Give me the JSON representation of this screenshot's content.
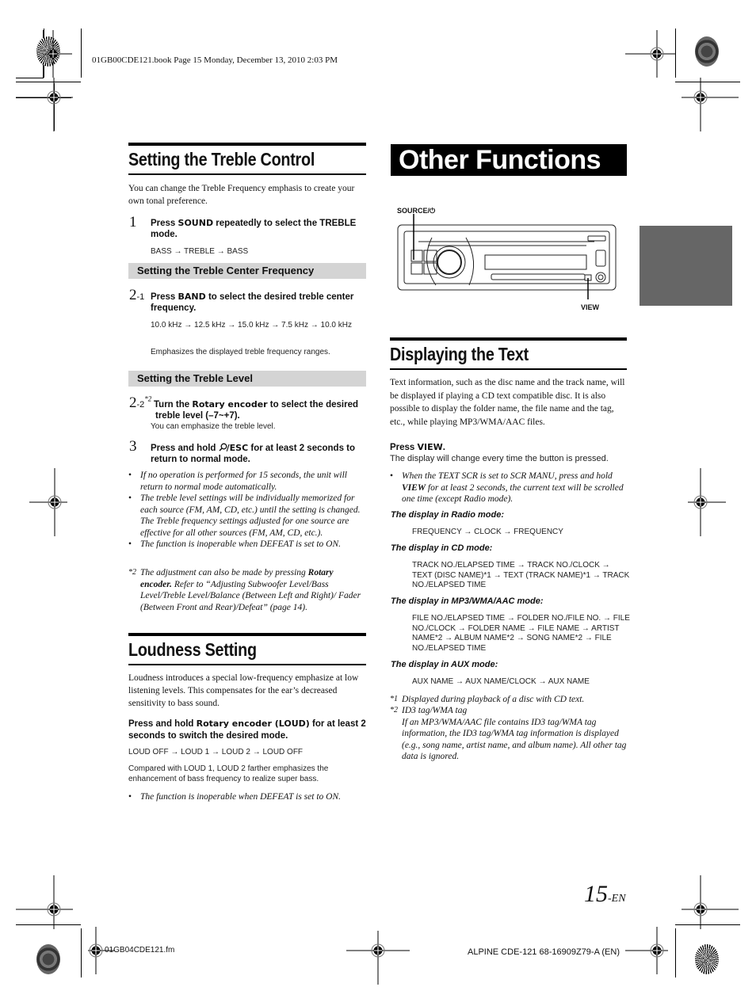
{
  "header": {
    "print_info": "01GB00CDE121.book  Page 15  Monday, December 13, 2010  2:03 PM"
  },
  "treble": {
    "title": "Setting the Treble Control",
    "intro": "You can change the Treble Frequency emphasis to create your own tonal preference.",
    "step1": {
      "num": "1",
      "text_pre": "Press ",
      "key": "SOUND",
      "text_post": " repeatedly to select the TREBLE mode.",
      "sequence": "BASS → TREBLE → BASS"
    },
    "center_freq_bar": "Setting the Treble Center Frequency",
    "step2_1": {
      "num": "2",
      "sub": "-1",
      "text_pre": "Press ",
      "key": "BAND",
      "text_post": " to select the desired treble center frequency.",
      "sequence": "10.0 kHz → 12.5 kHz → 15.0 kHz → 7.5 kHz → 10.0 kHz",
      "note": "Emphasizes the displayed treble frequency ranges."
    },
    "level_bar": "Setting the Treble Level",
    "step2_2": {
      "num": "2",
      "sub": "-2",
      "mark": "*2",
      "text_pre": "Turn the ",
      "key": "Rotary encoder",
      "text_post": " to select the desired treble level (–7~+7).",
      "note": "You can emphasize the treble level."
    },
    "step3": {
      "num": "3",
      "text_pre": "Press and hold ",
      "key": "/ESC",
      "text_post": " for at least 2 seconds to return to normal mode."
    },
    "bullets": [
      "If no operation is performed for 15 seconds, the unit will return to normal mode automatically.",
      "The treble level settings will be individually memorized for each source (FM, AM, CD, etc.) until the setting is changed. The Treble frequency settings adjusted for one source are effective for all other sources (FM, AM, CD, etc.).",
      "The function is inoperable when DEFEAT is set to ON."
    ],
    "footnote": {
      "mark": "*2",
      "pre": "The adjustment can also be made by pressing ",
      "bold": "Rotary encoder.",
      "post": " Refer to “Adjusting Subwoofer Level/Bass Level/Treble Level/Balance (Between Left and Right)/ Fader (Between Front and Rear)/Defeat” (page 14)."
    }
  },
  "loudness": {
    "title": "Loudness Setting",
    "intro": "Loudness introduces a special low-frequency emphasize at low listening levels. This compensates for the ear’s decreased sensitivity to bass sound.",
    "instr_pre": "Press and hold ",
    "instr_key": "Rotary encoder (LOUD)",
    "instr_post": " for at least 2 seconds to switch the desired mode.",
    "sequence": "LOUD OFF → LOUD 1 → LOUD 2 → LOUD OFF",
    "compare": "Compared with LOUD 1, LOUD 2 farther emphasizes the enhancement of bass frequency to realize super bass.",
    "bullet": "The function is inoperable when DEFEAT is set to ON."
  },
  "other": {
    "title": "Other Functions",
    "diagram": {
      "label_source": "SOURCE/⏻",
      "label_view": "VIEW"
    }
  },
  "display_text": {
    "title": "Displaying the Text",
    "intro": "Text information, such as the disc name and the track name, will be displayed if playing a CD text compatible disc. It is also possible to display the folder name, the file name and the tag, etc., while playing MP3/WMA/AAC files.",
    "press_pre": "Press ",
    "press_key": "VIEW",
    "press_post": ".",
    "press_note": "The display will change every time the button is pressed.",
    "bullet_pre": "When the TEXT SCR is set to SCR MANU, press and hold ",
    "bullet_key": "VIEW",
    "bullet_post": " for at least 2 seconds, the current text will be scrolled one time (except Radio mode).",
    "modes": [
      {
        "heading": "The display in Radio mode:",
        "sequence": "FREQUENCY → CLOCK → FREQUENCY"
      },
      {
        "heading": "The display in CD mode:",
        "sequence": "TRACK NO./ELAPSED TIME → TRACK NO./CLOCK → TEXT (DISC NAME)*1 → TEXT (TRACK NAME)*1 → TRACK NO./ELAPSED TIME"
      },
      {
        "heading": "The display in MP3/WMA/AAC mode:",
        "sequence": "FILE NO./ELAPSED TIME → FOLDER NO./FILE NO. → FILE NO./CLOCK → FOLDER NAME → FILE NAME → ARTIST NAME*2 → ALBUM NAME*2 → SONG NAME*2 → FILE NO./ELAPSED TIME"
      },
      {
        "heading": "The display in AUX mode:",
        "sequence": "AUX NAME → AUX NAME/CLOCK → AUX NAME"
      }
    ],
    "footnotes": [
      {
        "mark": "*1",
        "text": "Displayed during playback of a disc with CD text."
      },
      {
        "mark": "*2",
        "text": "ID3 tag/WMA tag"
      }
    ],
    "footnote2_detail": "If an MP3/WMA/AAC file contains ID3 tag/WMA tag information, the ID3 tag/WMA tag information is displayed (e.g., song name, artist name, and album name). All other tag data is ignored."
  },
  "footer": {
    "page_number": "15",
    "page_suffix": "-EN",
    "file_name": "01GB04CDE121.fm",
    "model_info": "ALPINE CDE-121 68-16909Z79-A (EN)"
  }
}
